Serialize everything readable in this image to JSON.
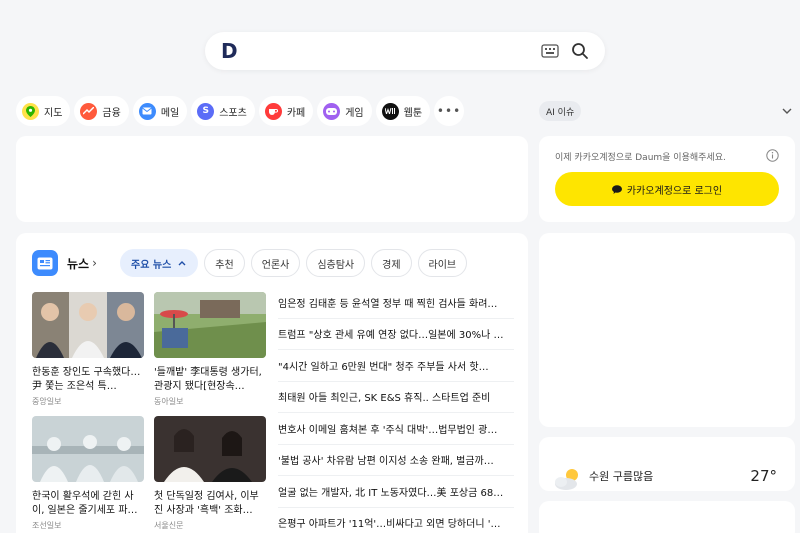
{
  "search": {
    "logo": "D",
    "placeholder": ""
  },
  "services": [
    {
      "label": "지도",
      "color": "#2db400",
      "glyph": ""
    },
    {
      "label": "금융",
      "color": "#ff5a3c",
      "glyph": ""
    },
    {
      "label": "메일",
      "color": "#3d8bfd",
      "glyph": ""
    },
    {
      "label": "스포츠",
      "color": "#5b6cf7",
      "glyph": "S"
    },
    {
      "label": "카페",
      "color": "#ff3b3b",
      "glyph": ""
    },
    {
      "label": "게임",
      "color": "#a060f0",
      "glyph": ""
    },
    {
      "label": "웹툰",
      "color": "#111111",
      "glyph": ""
    }
  ],
  "ai_issue": {
    "label": "AI 이슈"
  },
  "login": {
    "message": "이제 카카오계정으로 Daum을 이용해주세요.",
    "button": "카카오계정으로 로그인"
  },
  "news": {
    "title": "뉴스",
    "tabs": [
      "주요 뉴스",
      "추천",
      "언론사",
      "심층탐사",
      "경제",
      "라이브"
    ],
    "cards": [
      {
        "title": "한동훈 장인도 구속했다…尹 쫓는 조은석 특…",
        "source": "중앙일보"
      },
      {
        "title": "'들깨밭' 李대통령 생가터, 관광지 됐다[현장속…",
        "source": "동아일보"
      },
      {
        "title": "한국이 활우석에 갇힌 사이, 일본은 줄기세포 파…",
        "source": "조선일보"
      },
      {
        "title": "첫 단독일정 김여사, 이부진 사장과 '흑백' 조화…",
        "source": "서울신문"
      }
    ],
    "headlines": [
      "임은정 김태훈 등 윤석열 정부 때 찍힌 검사들 화려…",
      "트럼프 \"상호 관세 유예 연장 없다…일본에 30%나 …",
      "\"4시간 일하고 6만원 번대\" 청주 주부들 사서 핫…",
      "최태원 아들 최인근, SK E&S 휴직.. 스타트업 준비",
      "변호사 이메일 훔쳐본 후 '주식 대박'…법무법인 광…",
      "'불법 공사' 차유람 남편 이지성 소송 완패, 벌금까…",
      "얼굴 없는 개발자, 北 IT 노동자였다…美 포상금 68…",
      "은평구 아파트가 '11억'…비싸다고 외면 당하더니 '…"
    ]
  },
  "weather": {
    "location": "수원 구름많음",
    "temperature": "27°"
  }
}
